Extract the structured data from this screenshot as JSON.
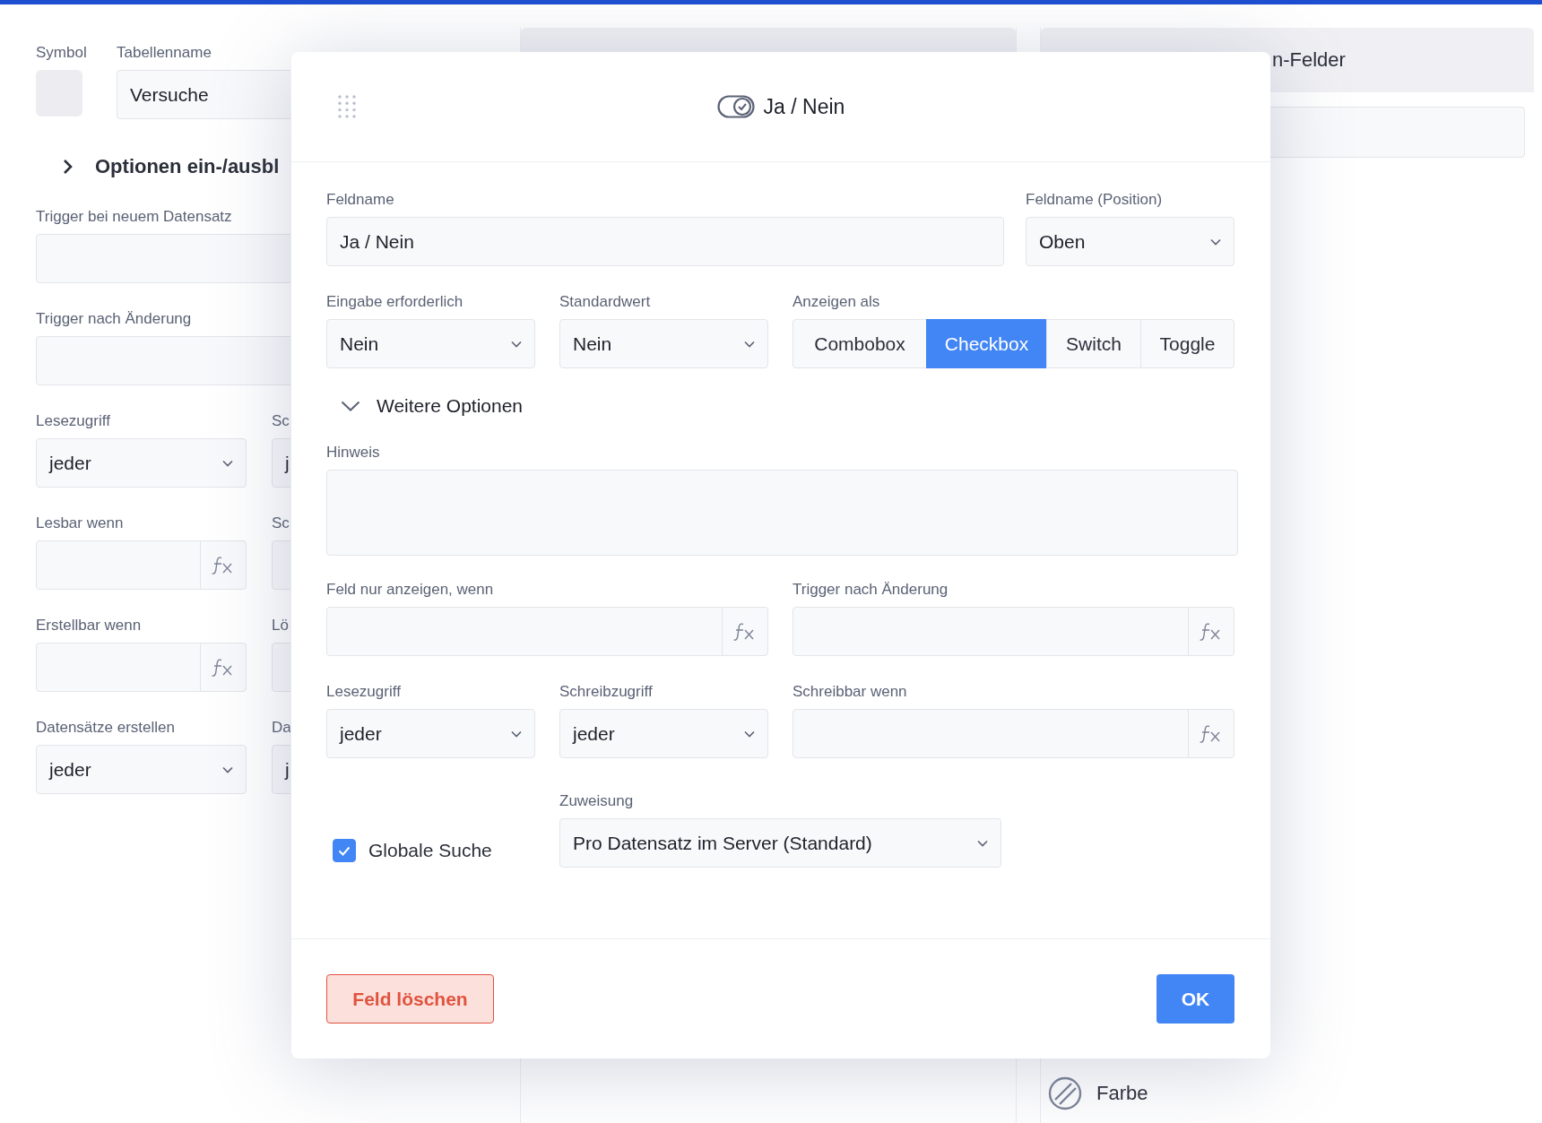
{
  "left_panel": {
    "symbol_label": "Symbol",
    "table_name_label": "Tabellenname",
    "table_name": "Versuche",
    "options_toggle": {
      "label": "Optionen ein-/ausbl",
      "expanded": false
    },
    "wide_fields": [
      {
        "label": "Trigger bei neuem Datensatz"
      },
      {
        "label": "Trigger nach Änderung"
      }
    ],
    "field_rows": [
      [
        {
          "kind": "select",
          "label": "Lesezugriff",
          "value": "jeder"
        },
        {
          "kind": "select",
          "label": "Sc",
          "value": "j"
        }
      ],
      [
        {
          "kind": "formula",
          "label": "Lesbar wenn"
        },
        {
          "kind": "formula",
          "label": "Sc"
        }
      ],
      [
        {
          "kind": "formula",
          "label": "Erstellbar wenn"
        },
        {
          "kind": "formula",
          "label": "Lö"
        }
      ],
      [
        {
          "kind": "select",
          "label": "Datensätze erstellen",
          "value": "jeder"
        },
        {
          "kind": "select",
          "label": "Da",
          "value": "j"
        }
      ]
    ]
  },
  "right_panel": {
    "title": "n-Felder",
    "items": [
      {
        "label": "Farbe"
      }
    ]
  },
  "dialog": {
    "title": "Ja / Nein",
    "field_name": {
      "label": "Feldname",
      "value": "Ja / Nein"
    },
    "field_name_position": {
      "label": "Feldname (Position)",
      "value": "Oben"
    },
    "required": {
      "label": "Eingabe erforderlich",
      "value": "Nein"
    },
    "default_value": {
      "label": "Standardwert",
      "value": "Nein"
    },
    "display_as": {
      "label": "Anzeigen als",
      "options": [
        {
          "label": "Combobox",
          "selected": false
        },
        {
          "label": "Checkbox",
          "selected": true
        },
        {
          "label": "Switch",
          "selected": false
        },
        {
          "label": "Toggle",
          "selected": false
        }
      ]
    },
    "more_options": {
      "label": "Weitere Optionen",
      "expanded": true
    },
    "hint": {
      "label": "Hinweis"
    },
    "formula_row": [
      {
        "kind": "formula",
        "label": "Feld nur anzeigen, wenn"
      },
      {
        "kind": "formula",
        "label": "Trigger nach Änderung"
      }
    ],
    "access_row": [
      {
        "kind": "select",
        "label": "Lesezugriff",
        "value": "jeder"
      },
      {
        "kind": "select",
        "label": "Schreibzugriff",
        "value": "jeder"
      },
      {
        "kind": "formula",
        "label": "Schreibbar wenn"
      }
    ],
    "global_search": {
      "label": "Globale Suche",
      "checked": true
    },
    "assignment": {
      "label": "Zuweisung",
      "value": "Pro Datensatz im Server (Standard)"
    },
    "delete_button": "Feld löschen",
    "ok_button": "OK"
  }
}
